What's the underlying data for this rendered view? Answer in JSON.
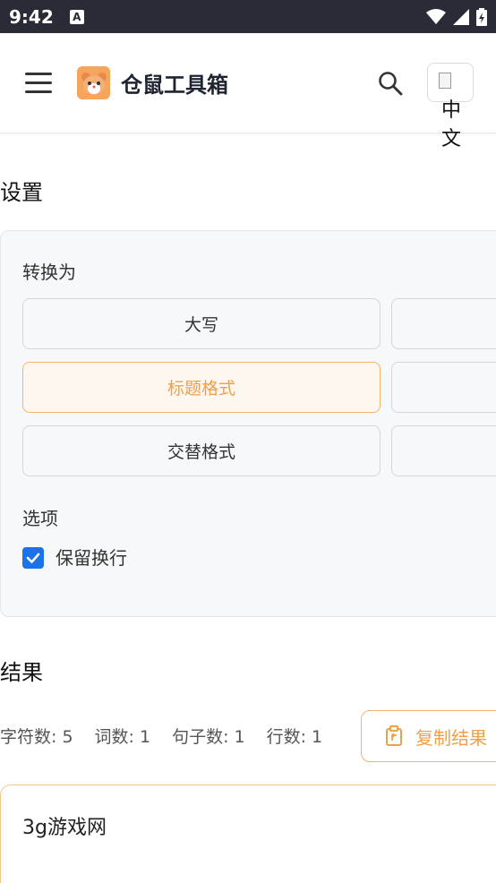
{
  "status": {
    "time": "9:42",
    "badge": "A"
  },
  "header": {
    "title": "仓鼠工具箱",
    "lang_line1": "中",
    "lang_line2": "文"
  },
  "settings": {
    "title": "设置",
    "convert_label": "转换为",
    "buttons": [
      {
        "label": "大写"
      },
      {
        "label": "标题格式"
      },
      {
        "label": "交替格式"
      }
    ],
    "options_label": "选项",
    "keep_newlines": "保留换行"
  },
  "result": {
    "title": "结果",
    "chars": "字符数: 5",
    "words": "词数: 1",
    "sentences": "句子数: 1",
    "lines": "行数: 1",
    "copy_label": "复制结果",
    "text": "3g游戏网"
  },
  "colors": {
    "accent": "#f0a04b",
    "checkbox": "#1a73e8",
    "statusbar": "#2b2b37"
  }
}
